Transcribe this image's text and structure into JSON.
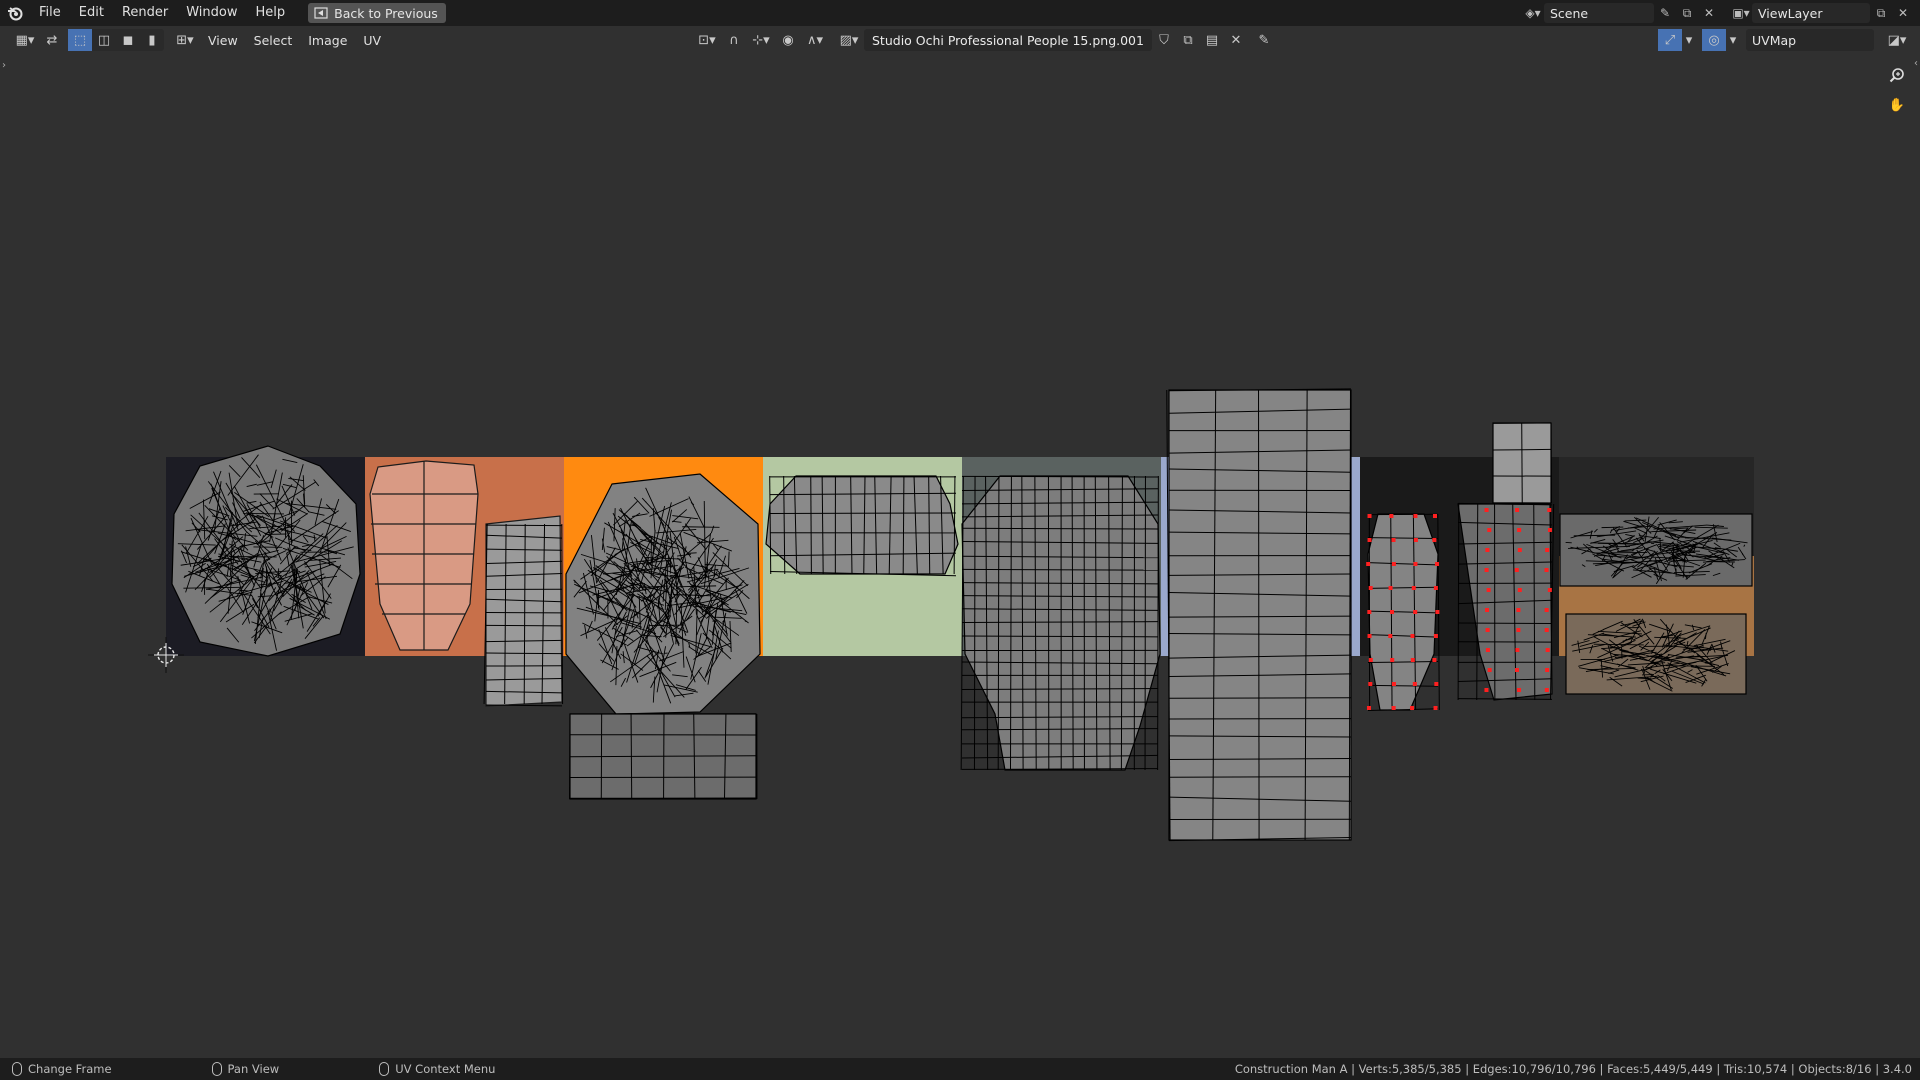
{
  "topbar": {
    "menu": [
      "File",
      "Edit",
      "Render",
      "Window",
      "Help"
    ],
    "back_label": "Back to Previous",
    "scene_label": "Scene",
    "viewlayer_label": "ViewLayer"
  },
  "header": {
    "menus": [
      "View",
      "Select",
      "Image",
      "UV"
    ],
    "image_name": "Studio Ochi Professional People 15.png.001",
    "uvmap_label": "UVMap"
  },
  "status": {
    "hint_change_frame": "Change Frame",
    "hint_pan_view": "Pan View",
    "hint_context_menu": "UV Context Menu",
    "stats": "Construction Man A | Verts:5,385/5,385 | Edges:10,796/10,796 | Faces:5,449/5,449 | Tris:10,574 | Objects:8/16 | 3.4.0"
  },
  "colors": {
    "accent": "#4772b3",
    "selected_vertex": "#ff2020"
  }
}
